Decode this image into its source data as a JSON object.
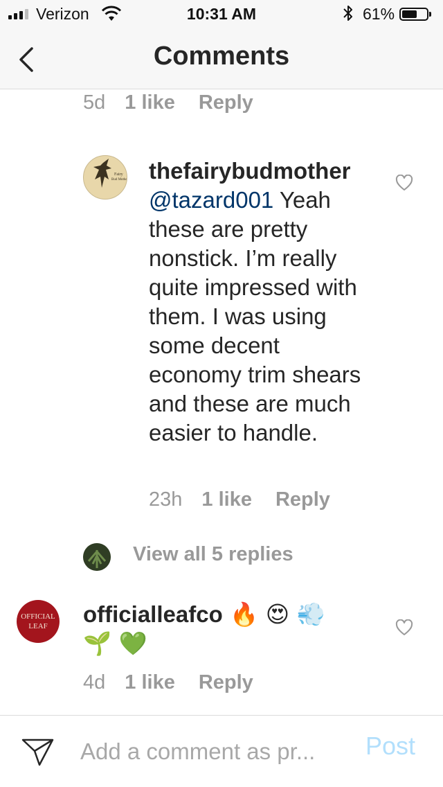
{
  "status_bar": {
    "carrier": "Verizon",
    "time": "10:31 AM",
    "battery_percent": "61%",
    "battery_level": 0.61
  },
  "nav": {
    "title": "Comments",
    "back_icon": "chevron-left-icon"
  },
  "comments": [
    {
      "time": "5d",
      "likes": "1 like",
      "reply_label": "Reply"
    },
    {
      "username": "thefairybudmother",
      "mention": "@tazard001",
      "text": " Yeah these are pretty nonstick. I’m really quite impressed with them. I was using some decent economy trim shears and these are much easier to handle.",
      "time": "23h",
      "likes": "1 like",
      "reply_label": "Reply",
      "avatar_text": "Fairy Bud Mother"
    },
    {
      "username": "officialleafco",
      "text": " 🔥 😍 💨 🌱 💚",
      "time": "4d",
      "likes": "1 like",
      "reply_label": "Reply",
      "avatar_text": "OFFICIAL LEAF"
    }
  ],
  "view_replies": "View all 5 replies",
  "composer": {
    "placeholder": "Add a comment as pr...",
    "post_label": "Post"
  },
  "colors": {
    "mention": "#003569",
    "meta": "#999999",
    "post_disabled": "#b2dffc",
    "leaf_avatar": "#a3151d"
  }
}
